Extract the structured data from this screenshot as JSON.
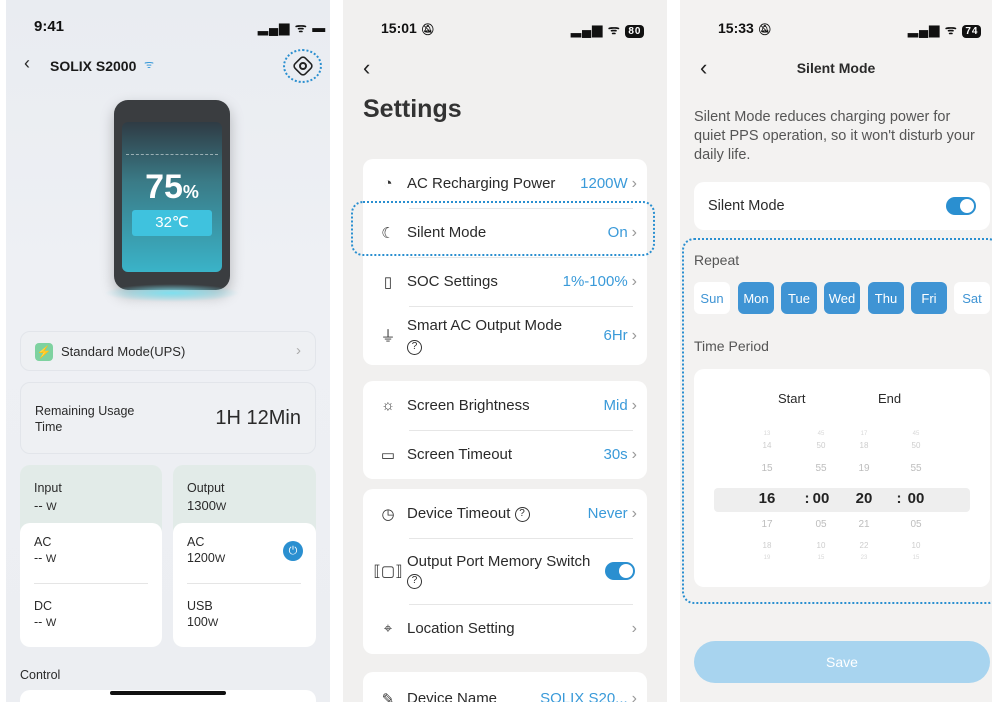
{
  "panel1": {
    "time": "9:41",
    "device_name": "SOLIX S2000",
    "battery_percent": "75",
    "percent_sign": "%",
    "temperature": "32℃",
    "mode_label": "Standard Mode(UPS)",
    "remaining_label": "Remaining Usage Time",
    "remaining_value": "1H 12Min",
    "input_label": "Input",
    "input_value": "--",
    "input_unit": "W",
    "output_label": "Output",
    "output_value": "1300",
    "output_unit": "W",
    "ac_in_label": "AC",
    "ac_in_value": "--",
    "ac_in_unit": "W",
    "dc_in_label": "DC",
    "dc_in_value": "--",
    "dc_in_unit": "W",
    "ac_out_label": "AC",
    "ac_out_value": "1200",
    "ac_out_unit": "W",
    "usb_label": "USB",
    "usb_value": "100",
    "usb_unit": "W",
    "control_label": "Control"
  },
  "panel2": {
    "time": "15:01",
    "battery": "80",
    "title": "Settings",
    "rows": [
      {
        "icon": "gauge-icon",
        "label": "AC Recharging Power",
        "value": "1200W"
      },
      {
        "icon": "moon-icon",
        "label": "Silent Mode",
        "value": "On"
      },
      {
        "icon": "battery-icon",
        "label": "SOC Settings",
        "value": "1%-100%"
      },
      {
        "icon": "plug-icon",
        "label": "Smart AC Output Mode",
        "value": "6Hr"
      },
      {
        "icon": "sun-icon",
        "label": "Screen Brightness",
        "value": "Mid"
      },
      {
        "icon": "screen-icon",
        "label": "Screen Timeout",
        "value": "30s"
      },
      {
        "icon": "timer-icon",
        "label": "Device Timeout",
        "value": "Never"
      },
      {
        "icon": "port-icon",
        "label": "Output Port Memory Switch",
        "value": ""
      },
      {
        "icon": "location-icon",
        "label": "Location Setting",
        "value": ""
      },
      {
        "icon": "pencil-icon",
        "label": "Device Name",
        "value": "SOLIX S20..."
      }
    ],
    "help": "?"
  },
  "panel3": {
    "time": "15:33",
    "battery": "74",
    "title": "Silent Mode",
    "description": "Silent Mode reduces charging power for quiet PPS operation, so it won't disturb your daily life.",
    "toggle_label": "Silent Mode",
    "repeat_label": "Repeat",
    "days": [
      {
        "name": "Sun",
        "selected": false
      },
      {
        "name": "Mon",
        "selected": true
      },
      {
        "name": "Tue",
        "selected": true
      },
      {
        "name": "Wed",
        "selected": true
      },
      {
        "name": "Thu",
        "selected": true
      },
      {
        "name": "Fri",
        "selected": true
      },
      {
        "name": "Sat",
        "selected": false
      }
    ],
    "time_period_label": "Time Period",
    "start_label": "Start",
    "end_label": "End",
    "picker": {
      "start_hours": [
        "13",
        "14",
        "15",
        "16",
        "17",
        "18",
        "19"
      ],
      "start_minutes": [
        "45",
        "50",
        "55",
        "00",
        "05",
        "10",
        "15"
      ],
      "end_hours": [
        "17",
        "18",
        "19",
        "20",
        "21",
        "22",
        "23"
      ],
      "end_minutes": [
        "45",
        "50",
        "55",
        "00",
        "05",
        "10",
        "15"
      ],
      "selected_start_hour": "16",
      "selected_start_minute": "00",
      "selected_end_hour": "20",
      "selected_end_minute": "00",
      "separator": ":"
    },
    "save_label": "Save",
    "accent": "#3a9ad9"
  }
}
